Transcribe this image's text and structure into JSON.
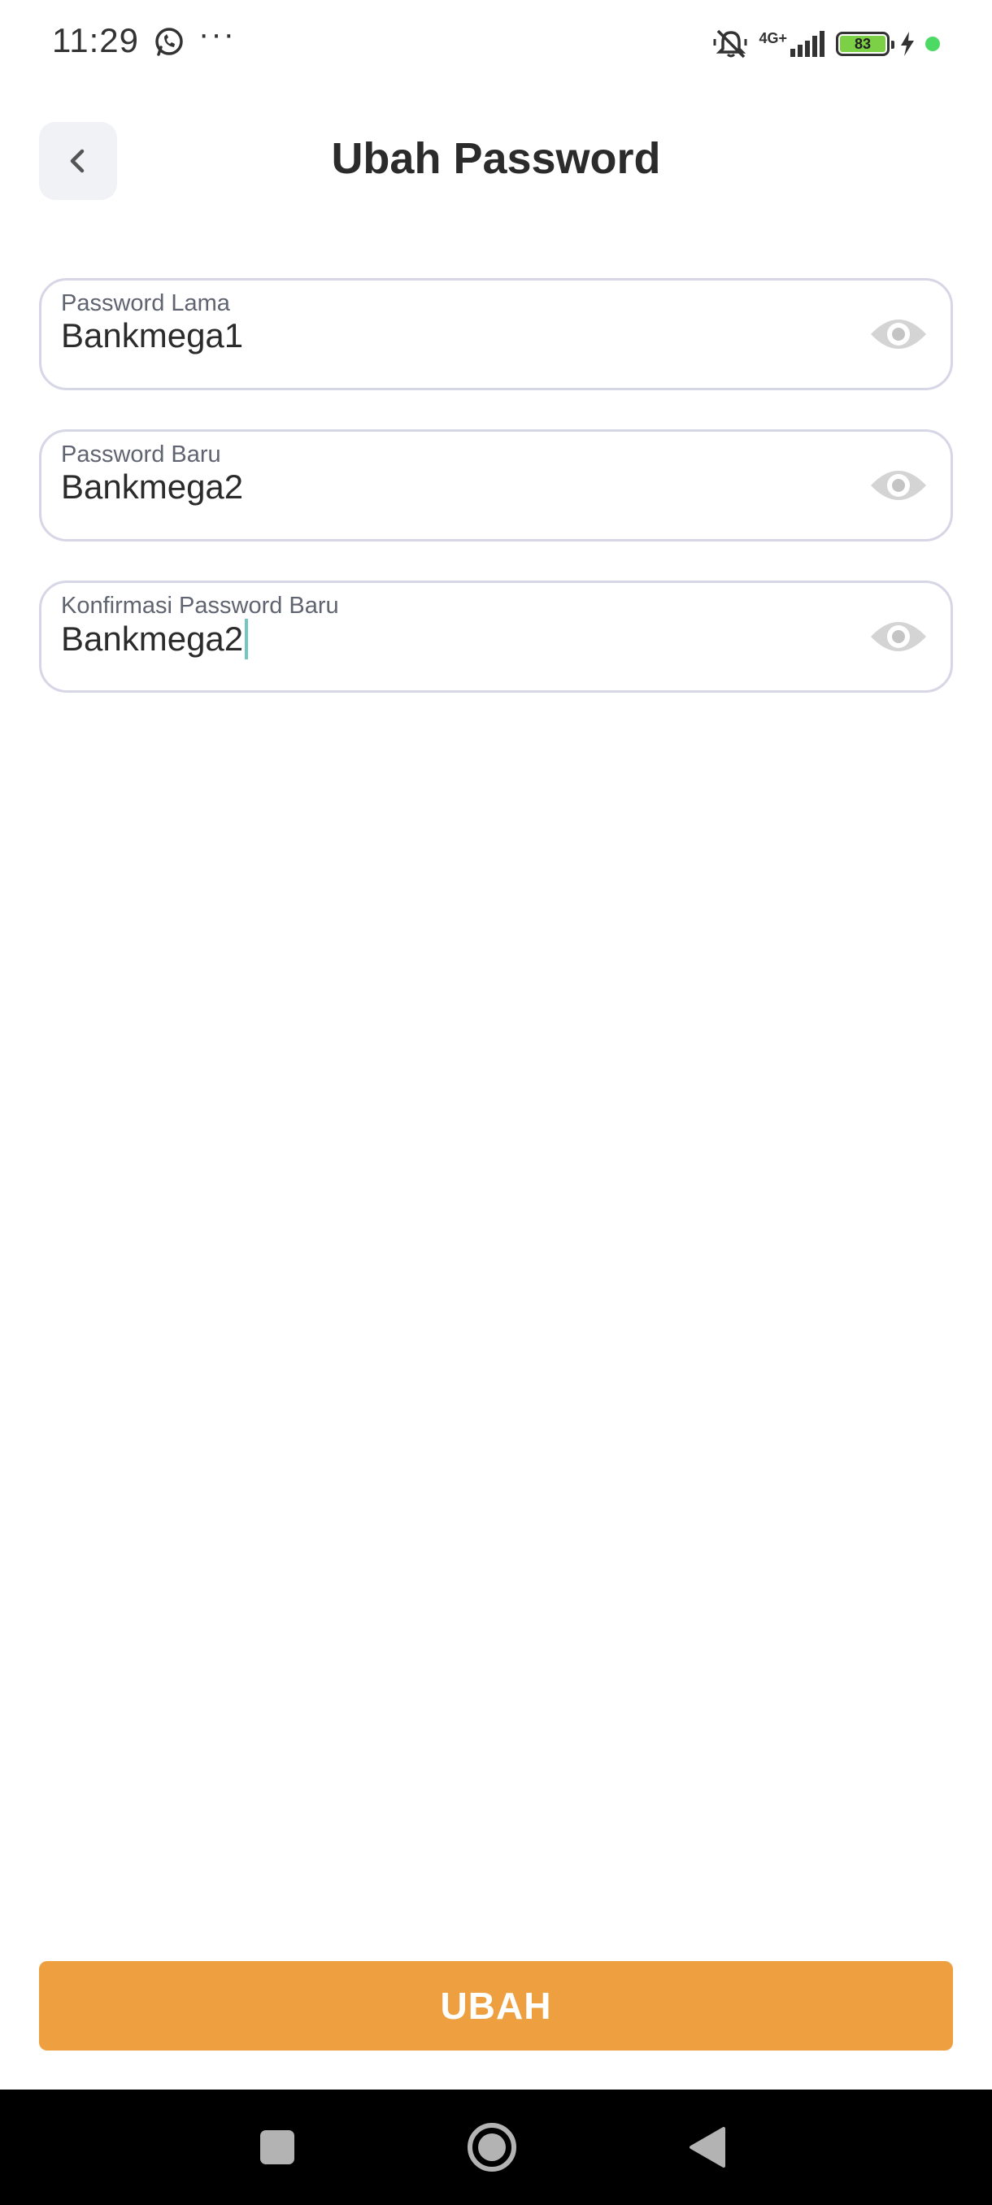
{
  "status_bar": {
    "time": "11:29",
    "more": "···",
    "network": "4G+",
    "battery": "83",
    "icons": [
      "whatsapp-icon",
      "mute-icon",
      "signal-icon",
      "battery-icon",
      "charging-icon"
    ]
  },
  "header": {
    "title": "Ubah Password",
    "back_icon": "chevron-left-icon"
  },
  "form": {
    "fields": [
      {
        "label": "Password Lama",
        "value": "Bankmega1",
        "icon": "eye-icon"
      },
      {
        "label": "Password Baru",
        "value": "Bankmega2",
        "icon": "eye-icon"
      },
      {
        "label": "Konfirmasi Password Baru",
        "value": "Bankmega2",
        "icon": "eye-icon",
        "focused": true
      }
    ],
    "submit_label": "UBAH"
  },
  "colors": {
    "accent": "#eea040",
    "field_border": "#d6d6e6",
    "caret": "#74c7c0",
    "charging_dot": "#4cd964"
  },
  "nav": {
    "icons": [
      "recents-square-icon",
      "home-circle-icon",
      "back-triangle-icon"
    ]
  }
}
